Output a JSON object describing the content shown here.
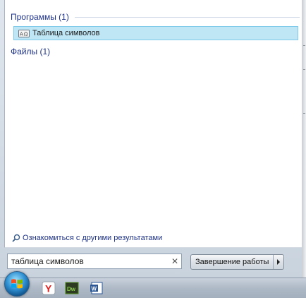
{
  "groups": {
    "programs": {
      "header": "Программы (1)",
      "items": [
        {
          "label": "Таблица символов"
        }
      ]
    },
    "files": {
      "header": "Файлы (1)"
    }
  },
  "more_results": {
    "label": "Ознакомиться с другими результатами",
    "icon": "search-icon"
  },
  "search": {
    "value": "таблица символов",
    "clear_icon": "clear-icon"
  },
  "shutdown": {
    "label": "Завершение работы",
    "arrow_icon": "chevron-right-icon"
  },
  "taskbar": {
    "start": {
      "icon": "windows-logo-icon"
    },
    "apps": [
      {
        "name": "yandex-browser",
        "icon": "yandex-browser-icon"
      },
      {
        "name": "dreamweaver",
        "icon": "dreamweaver-icon",
        "label": "Dw"
      },
      {
        "name": "word",
        "icon": "word-icon",
        "label": "W"
      }
    ]
  },
  "colors": {
    "header_text": "#1e3287",
    "selection_fill": "#bfe6f5",
    "selection_border": "#7fc9ea",
    "dreamweaver": "#4f8a1e",
    "word": "#2b5797",
    "yandex": "#e02020"
  }
}
